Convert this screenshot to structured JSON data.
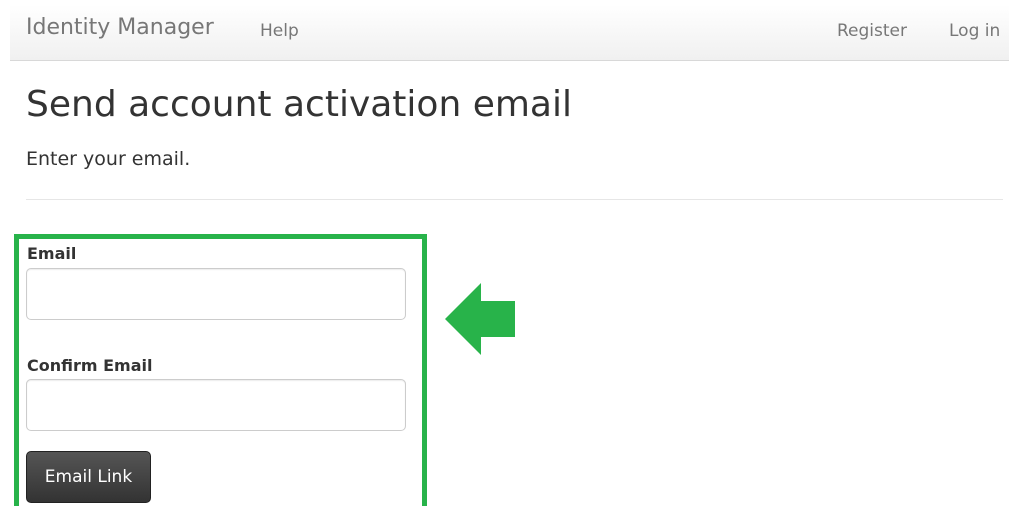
{
  "navbar": {
    "brand": "Identity Manager",
    "links": {
      "help": "Help",
      "register": "Register",
      "login": "Log in"
    }
  },
  "page": {
    "title": "Send account activation email",
    "subtitle": "Enter your email."
  },
  "form": {
    "email_label": "Email",
    "email_value": "",
    "confirm_label": "Confirm Email",
    "confirm_value": "",
    "submit_label": "Email Link"
  },
  "annotation": {
    "highlight_color": "#28b34a",
    "arrow_icon": "left-arrow-icon"
  }
}
